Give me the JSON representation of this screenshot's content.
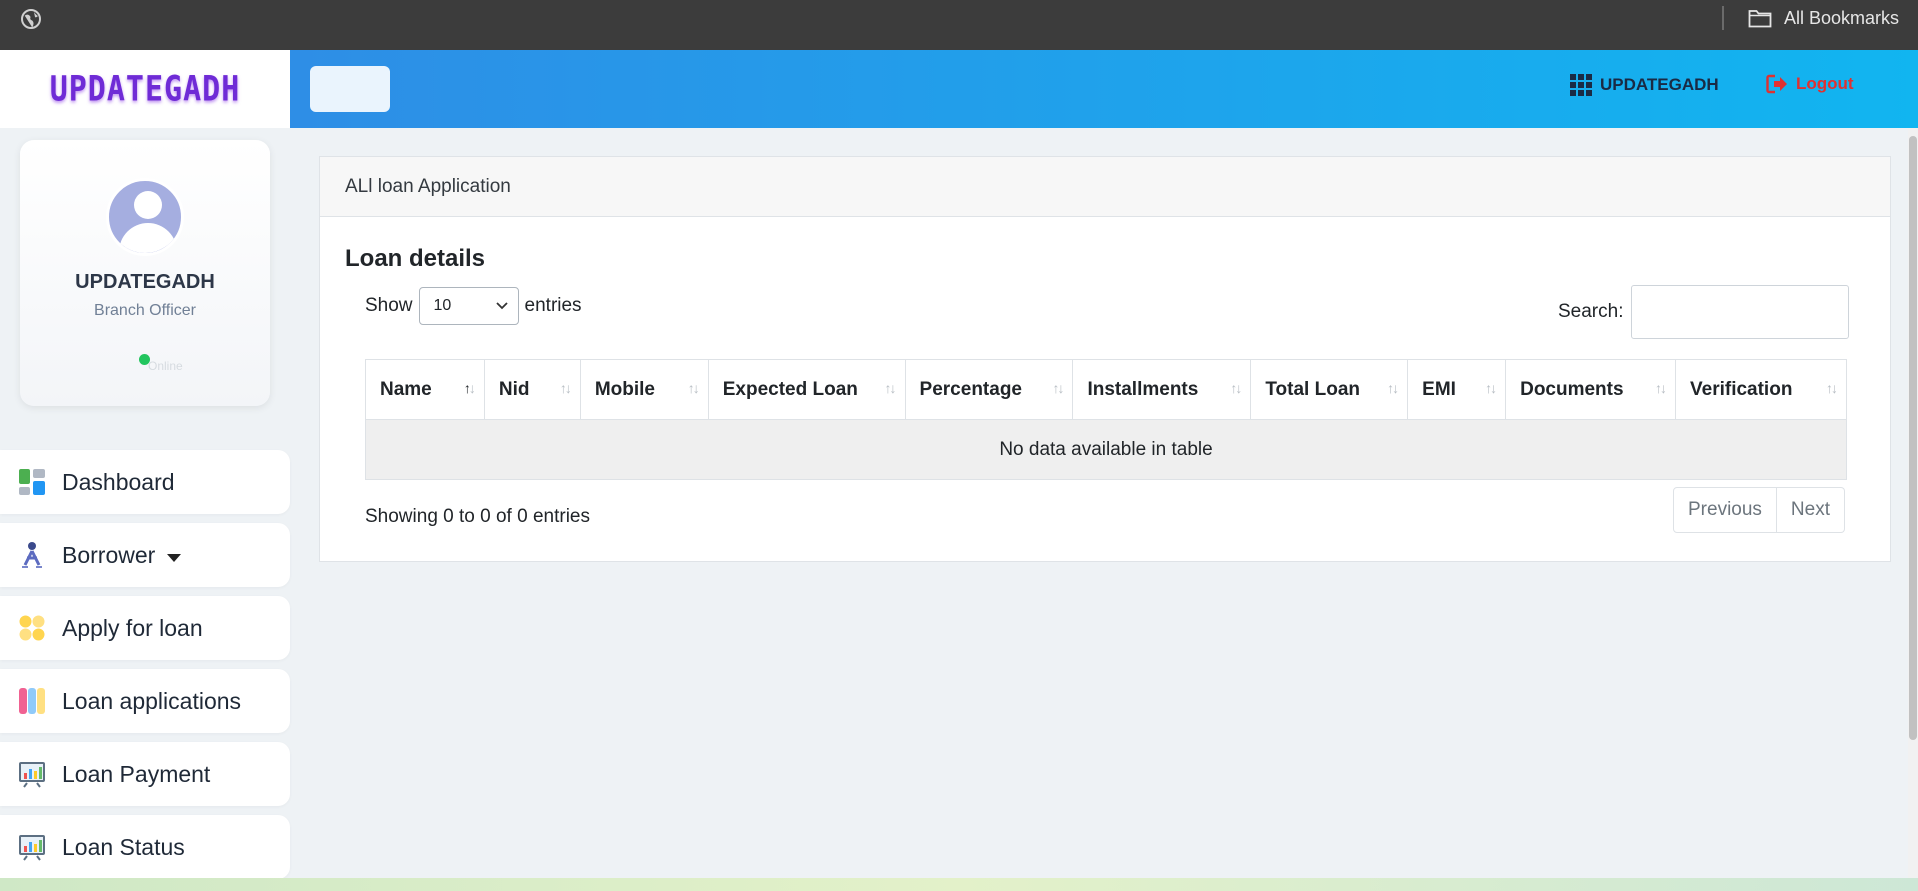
{
  "browser": {
    "bookmarks_label": "All Bookmarks"
  },
  "sidebar": {
    "brand": "UPDATEGADH",
    "profile": {
      "name": "UPDATEGADH",
      "role": "Branch Officer",
      "status": "Online"
    },
    "items": [
      {
        "label": "Dashboard",
        "icon": "dashboard-icon"
      },
      {
        "label": "Borrower",
        "icon": "borrower-icon"
      },
      {
        "label": "Apply for loan",
        "icon": "apply-loan-icon"
      },
      {
        "label": "Loan applications",
        "icon": "loan-applications-icon"
      },
      {
        "label": "Loan Payment",
        "icon": "loan-payment-icon"
      },
      {
        "label": "Loan Status",
        "icon": "loan-status-icon"
      }
    ]
  },
  "header": {
    "brand": "UPDATEGADH",
    "logout": "Logout"
  },
  "main": {
    "card_header": "ALl loan Application",
    "title": "Loan details",
    "show_label": "Show",
    "entries_label": "entries",
    "page_length": "10",
    "search_label": "Search:",
    "search_value": "",
    "columns": [
      "Name",
      "Nid",
      "Mobile",
      "Expected Loan",
      "Percentage",
      "Installments",
      "Total Loan",
      "EMI",
      "Documents",
      "Verification"
    ],
    "empty_message": "No data available in table",
    "info": "Showing 0 to 0 of 0 entries",
    "prev_label": "Previous",
    "next_label": "Next"
  },
  "colors": {
    "header_gradient_start": "#2e8ee6",
    "header_gradient_end": "#11b5f0",
    "brand": "#6f2bd6",
    "logout": "#e03131",
    "status_online": "#22c55e"
  }
}
